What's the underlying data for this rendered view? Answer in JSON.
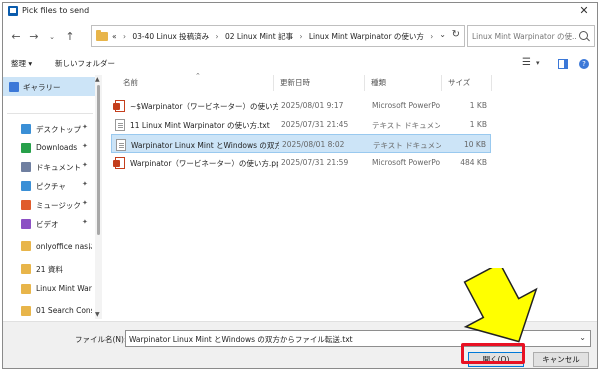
{
  "window": {
    "title": "Pick files to send",
    "close_glyph": "✕"
  },
  "address": {
    "crumbs": [
      "«",
      "03-40 Linux 投稿済み",
      "02 Linux Mint 記事",
      "Linux Mint Warpinator の使い方"
    ],
    "dropdown_glyph": "⌄",
    "refresh_glyph": "↻"
  },
  "search": {
    "placeholder": "Linux Mint Warpinator の使..."
  },
  "toolbar": {
    "organize": "整理 ▾",
    "new_folder": "新しいフォルダー"
  },
  "nav": {
    "items": [
      {
        "label": "ギャラリー",
        "icon": "gallery-icon",
        "color": "#3b78d8",
        "pinned": false,
        "selected": true
      },
      {
        "label": "デスクトップ",
        "icon": "desktop-icon",
        "color": "#3a8fd6",
        "pinned": true,
        "selected": false
      },
      {
        "label": "Downloads",
        "icon": "download-icon",
        "color": "#27a04a",
        "pinned": true,
        "selected": false
      },
      {
        "label": "ドキュメント",
        "icon": "documents-icon",
        "color": "#6f7fa0",
        "pinned": true,
        "selected": false
      },
      {
        "label": "ピクチャ",
        "icon": "pictures-icon",
        "color": "#3a8fd6",
        "pinned": true,
        "selected": false
      },
      {
        "label": "ミュージック",
        "icon": "music-icon",
        "color": "#e05c2c",
        "pinned": true,
        "selected": false
      },
      {
        "label": "ビデオ",
        "icon": "videos-icon",
        "color": "#8c4fc4",
        "pinned": true,
        "selected": false
      },
      {
        "label": "onlyoffice nasに",
        "icon": "folder-icon",
        "color": "#e8b54a",
        "pinned": false,
        "selected": false
      },
      {
        "label": "21 資料",
        "icon": "folder-icon",
        "color": "#e8b54a",
        "pinned": false,
        "selected": false
      },
      {
        "label": "Linux Mint Warp",
        "icon": "folder-icon",
        "color": "#e8b54a",
        "pinned": false,
        "selected": false
      },
      {
        "label": "01 Search Conso",
        "icon": "folder-icon",
        "color": "#e8b54a",
        "pinned": false,
        "selected": false
      }
    ],
    "pin_glyph": "📌"
  },
  "columns": {
    "name": "名前",
    "date": "更新日時",
    "type": "種類",
    "size": "サイズ"
  },
  "files": [
    {
      "name": "~$Warpinator（ワービネーター）の使い方.pptx",
      "date": "2025/08/01 9:17",
      "type": "Microsoft PowerPoint",
      "size": "1 KB",
      "icon": "ppt",
      "selected": false
    },
    {
      "name": "11 Linux Mint Warpinator の使い方.txt",
      "date": "2025/07/31 21:45",
      "type": "テキスト ドキュメント",
      "size": "1 KB",
      "icon": "txt",
      "selected": false
    },
    {
      "name": "Warpinator Linux Mint とWindows の双方からファイル転送.txt",
      "date": "2025/08/01 8:02",
      "type": "テキスト ドキュメント",
      "size": "10 KB",
      "icon": "txt",
      "selected": true
    },
    {
      "name": "Warpinator（ワービネーター）の使い方.pptx",
      "date": "2025/07/31 21:59",
      "type": "Microsoft PowerPoint",
      "size": "484 KB",
      "icon": "ppt",
      "selected": false
    }
  ],
  "bottom": {
    "filename_label": "ファイル名(N):",
    "filename_value": "Warpinator Linux Mint とWindows の双方からファイル転送.txt",
    "open_button": "開く(O)",
    "cancel_button": "キャンセル"
  },
  "colors": {
    "accent": "#0078d7",
    "selection": "#cce4f7",
    "annotation_border": "#e81123",
    "annotation_arrow": "#ffff00"
  }
}
